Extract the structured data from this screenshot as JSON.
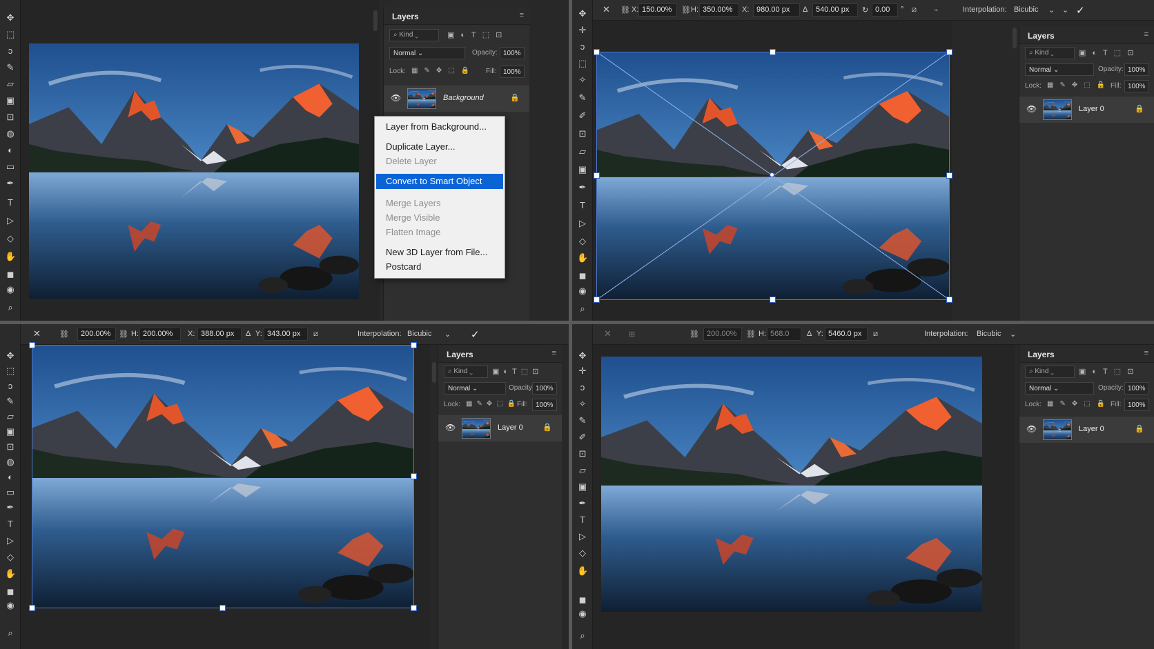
{
  "colors": {
    "accent": "#0a64d6",
    "bg": "#282828",
    "panel": "#2f2f2f",
    "handle_border": "#2f63c9"
  },
  "icons": [
    "move-icon",
    "marquee-icon",
    "lasso-icon",
    "brush-icon",
    "eraser-icon",
    "gradient-icon",
    "pen-icon",
    "type-icon",
    "path-select-icon",
    "shape-icon",
    "hand-icon",
    "zoom-icon"
  ],
  "q1": {
    "layers_panel": {
      "title": "Layers",
      "kind_label": "Kind",
      "blend_mode": "Normal",
      "opacity_label": "Opacity:",
      "opacity_value": "100%",
      "lock_label": "Lock:",
      "fill_label": "Fill:",
      "fill_value": "100%",
      "layer_name": "Background"
    },
    "context_menu": [
      {
        "label": "Layer from Background...",
        "state": "enabled"
      },
      {
        "label": "Duplicate Layer...",
        "state": "enabled"
      },
      {
        "label": "Delete Layer",
        "state": "disabled"
      },
      {
        "label": "Convert to Smart Object",
        "state": "highlighted"
      },
      {
        "label": "Merge Layers",
        "state": "disabled"
      },
      {
        "label": "Merge Visible",
        "state": "disabled"
      },
      {
        "label": "Flatten Image",
        "state": "disabled"
      },
      {
        "label": "New 3D Layer from File...",
        "state": "enabled"
      },
      {
        "label": "Postcard",
        "state": "enabled"
      }
    ]
  },
  "q2": {
    "options": {
      "w_pct": "150.00%",
      "h_label": "H:",
      "h_pct": "350.00%",
      "x_label": "X:",
      "x_val": "980.00 px",
      "y_val": "540.00 px",
      "angle": "0.00",
      "angle_unit": "°",
      "interp_label": "Interpolation:",
      "interp_value": "Bicubic"
    },
    "layers_panel": {
      "title": "Layers",
      "kind_label": "Kind",
      "blend_mode": "Normal",
      "opacity_label": "Opacity:",
      "opacity_value": "100%",
      "lock_label": "Lock:",
      "fill_label": "Fill:",
      "fill_value": "100%",
      "layer_name": "Layer 0"
    }
  },
  "q3": {
    "options": {
      "w_pct": "200.00%",
      "h_label": "H:",
      "h_pct": "200.00%",
      "x_label": "X:",
      "x_val": "388.00 px",
      "y_label": "Y:",
      "y_val": "343.00 px",
      "interp_label": "Interpolation:",
      "interp_value": "Bicubic"
    },
    "layers_panel": {
      "title": "Layers",
      "kind_label": "Kind",
      "blend_mode": "Normal",
      "opacity_label": "Opacity:",
      "opacity_value": "100%",
      "lock_label": "Lock:",
      "fill_label": "Fill:",
      "fill_value": "100%",
      "layer_name": "Layer 0"
    }
  },
  "q4": {
    "options": {
      "w_pct": "200.00%",
      "h_label": "H:",
      "h_pct": "568.0",
      "y_label": "Y:",
      "y_val": "5460.0 px",
      "interp_label": "Interpolation:",
      "interp_value": "Bicubic"
    },
    "layers_panel": {
      "title": "Layers",
      "kind_label": "Kind",
      "blend_mode": "Normal",
      "opacity_label": "Opacity:",
      "opacity_value": "100%",
      "lock_label": "Lock:",
      "fill_label": "Fill:",
      "fill_value": "100%",
      "layer_name": "Layer 0"
    }
  }
}
